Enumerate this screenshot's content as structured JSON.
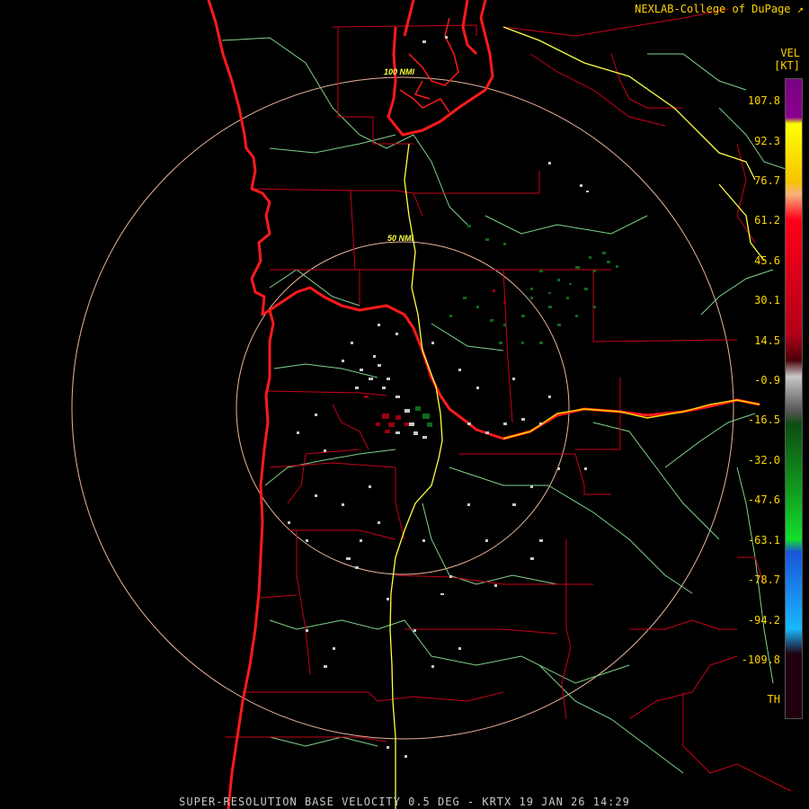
{
  "credit": "NEXLAB-College of DuPage",
  "legend": {
    "product": "VEL",
    "unit": "[KT]",
    "ticks": [
      "107.8",
      "92.3",
      "76.7",
      "61.2",
      "45.6",
      "30.1",
      "14.5",
      "-0.9",
      "-16.5",
      "-32.0",
      "-47.6",
      "-63.1",
      "-78.7",
      "-94.2",
      "-109.8",
      "TH"
    ],
    "colors": {
      "purple": "#7a0080",
      "yellow": "#ffff00",
      "peach": "#f7b27c",
      "red": "#ff0018",
      "dark_red": "#7a0010",
      "gray": "#c8c8c8",
      "dark_green": "#0e4d14",
      "green": "#12e02a",
      "blue": "#1a55d8",
      "cyan": "#19b8ff"
    }
  },
  "range_rings": {
    "inner": "50 NMI",
    "outer": "100 NMI"
  },
  "footer": "SUPER-RESOLUTION BASE VELOCITY 0.5 DEG - KRTX 19 JAN 26 14:29"
}
